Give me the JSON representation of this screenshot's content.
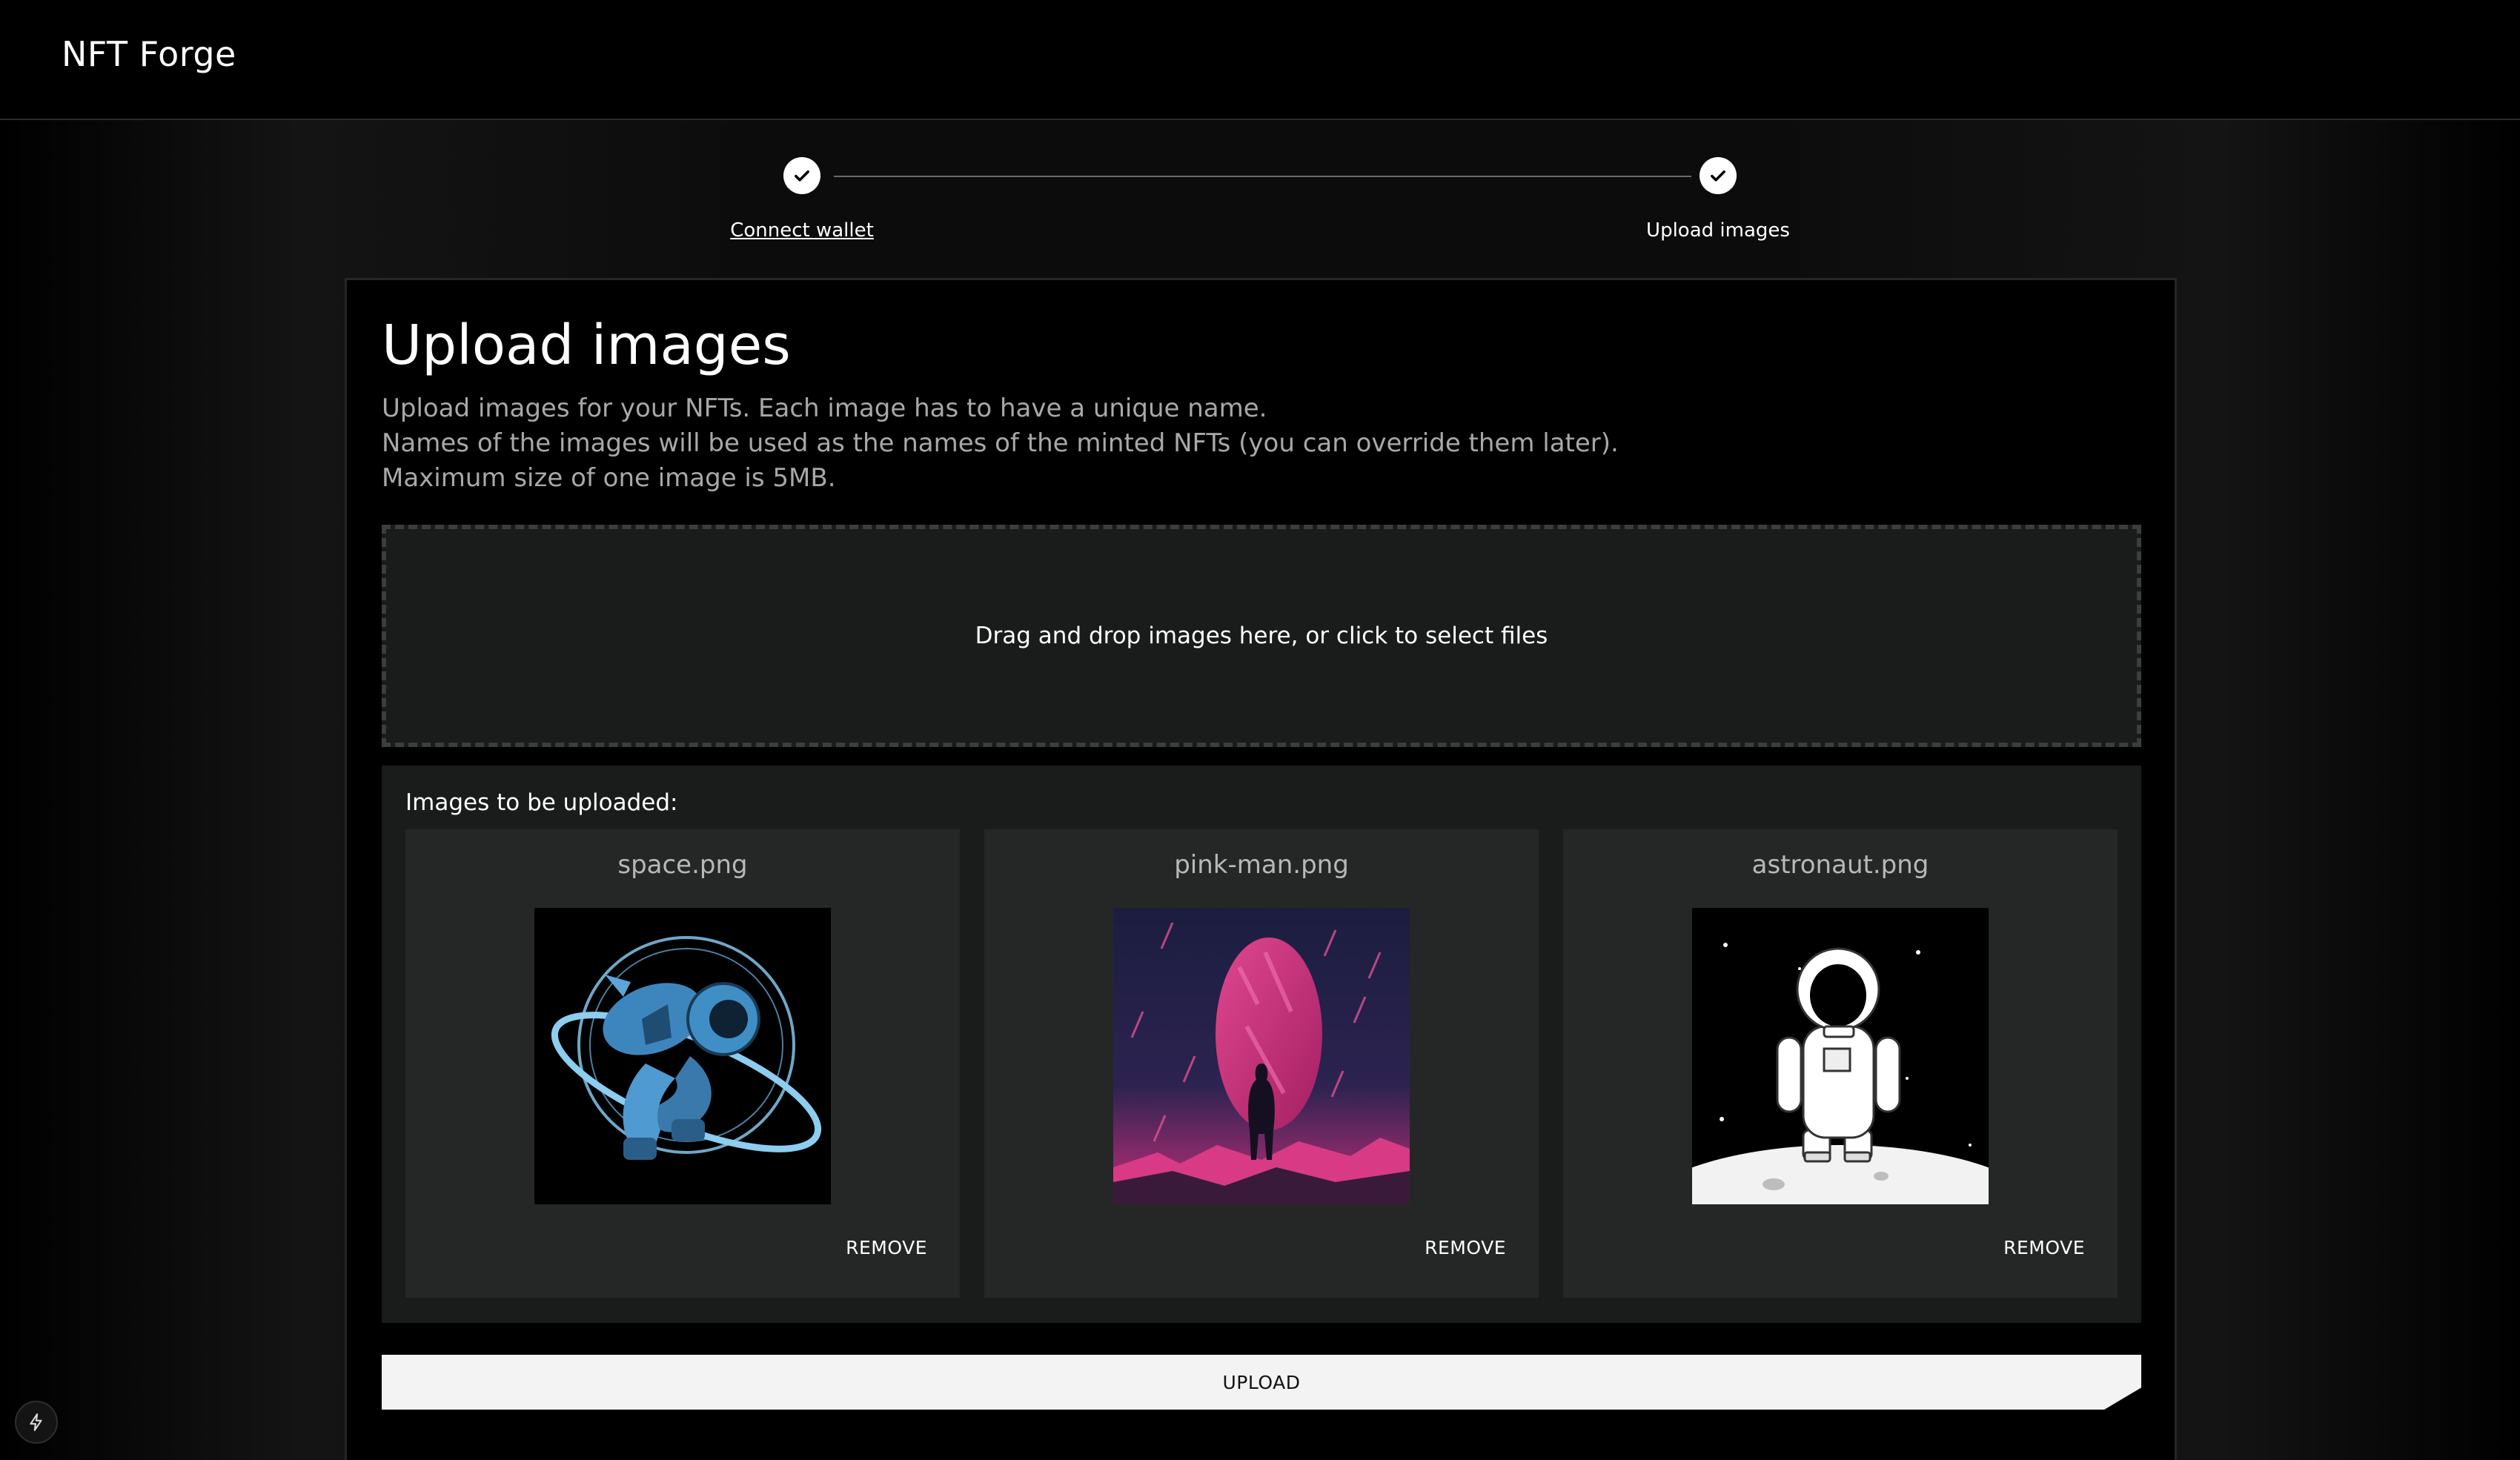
{
  "app": {
    "title": "NFT Forge"
  },
  "stepper": {
    "steps": [
      {
        "label": "Connect wallet",
        "completed": true,
        "link": true
      },
      {
        "label": "Upload images",
        "completed": true,
        "link": false
      }
    ]
  },
  "main": {
    "title": "Upload images",
    "description": [
      "Upload images for your NFTs. Each image has to have a unique name.",
      "Names of the images will be used as the names of the minted NFTs (you can override them later).",
      "Maximum size of one image is 5MB."
    ],
    "dropzone_text": "Drag and drop images here, or click to select files",
    "images_heading": "Images to be uploaded:",
    "images": [
      {
        "name": "space.png",
        "remove_label": "REMOVE"
      },
      {
        "name": "pink-man.png",
        "remove_label": "REMOVE"
      },
      {
        "name": "astronaut.png",
        "remove_label": "REMOVE"
      }
    ],
    "upload_label": "UPLOAD"
  },
  "colors": {
    "background": "#000000",
    "panel": "#1a1c1c",
    "card": "#252727",
    "button": "#f3f3f3"
  }
}
